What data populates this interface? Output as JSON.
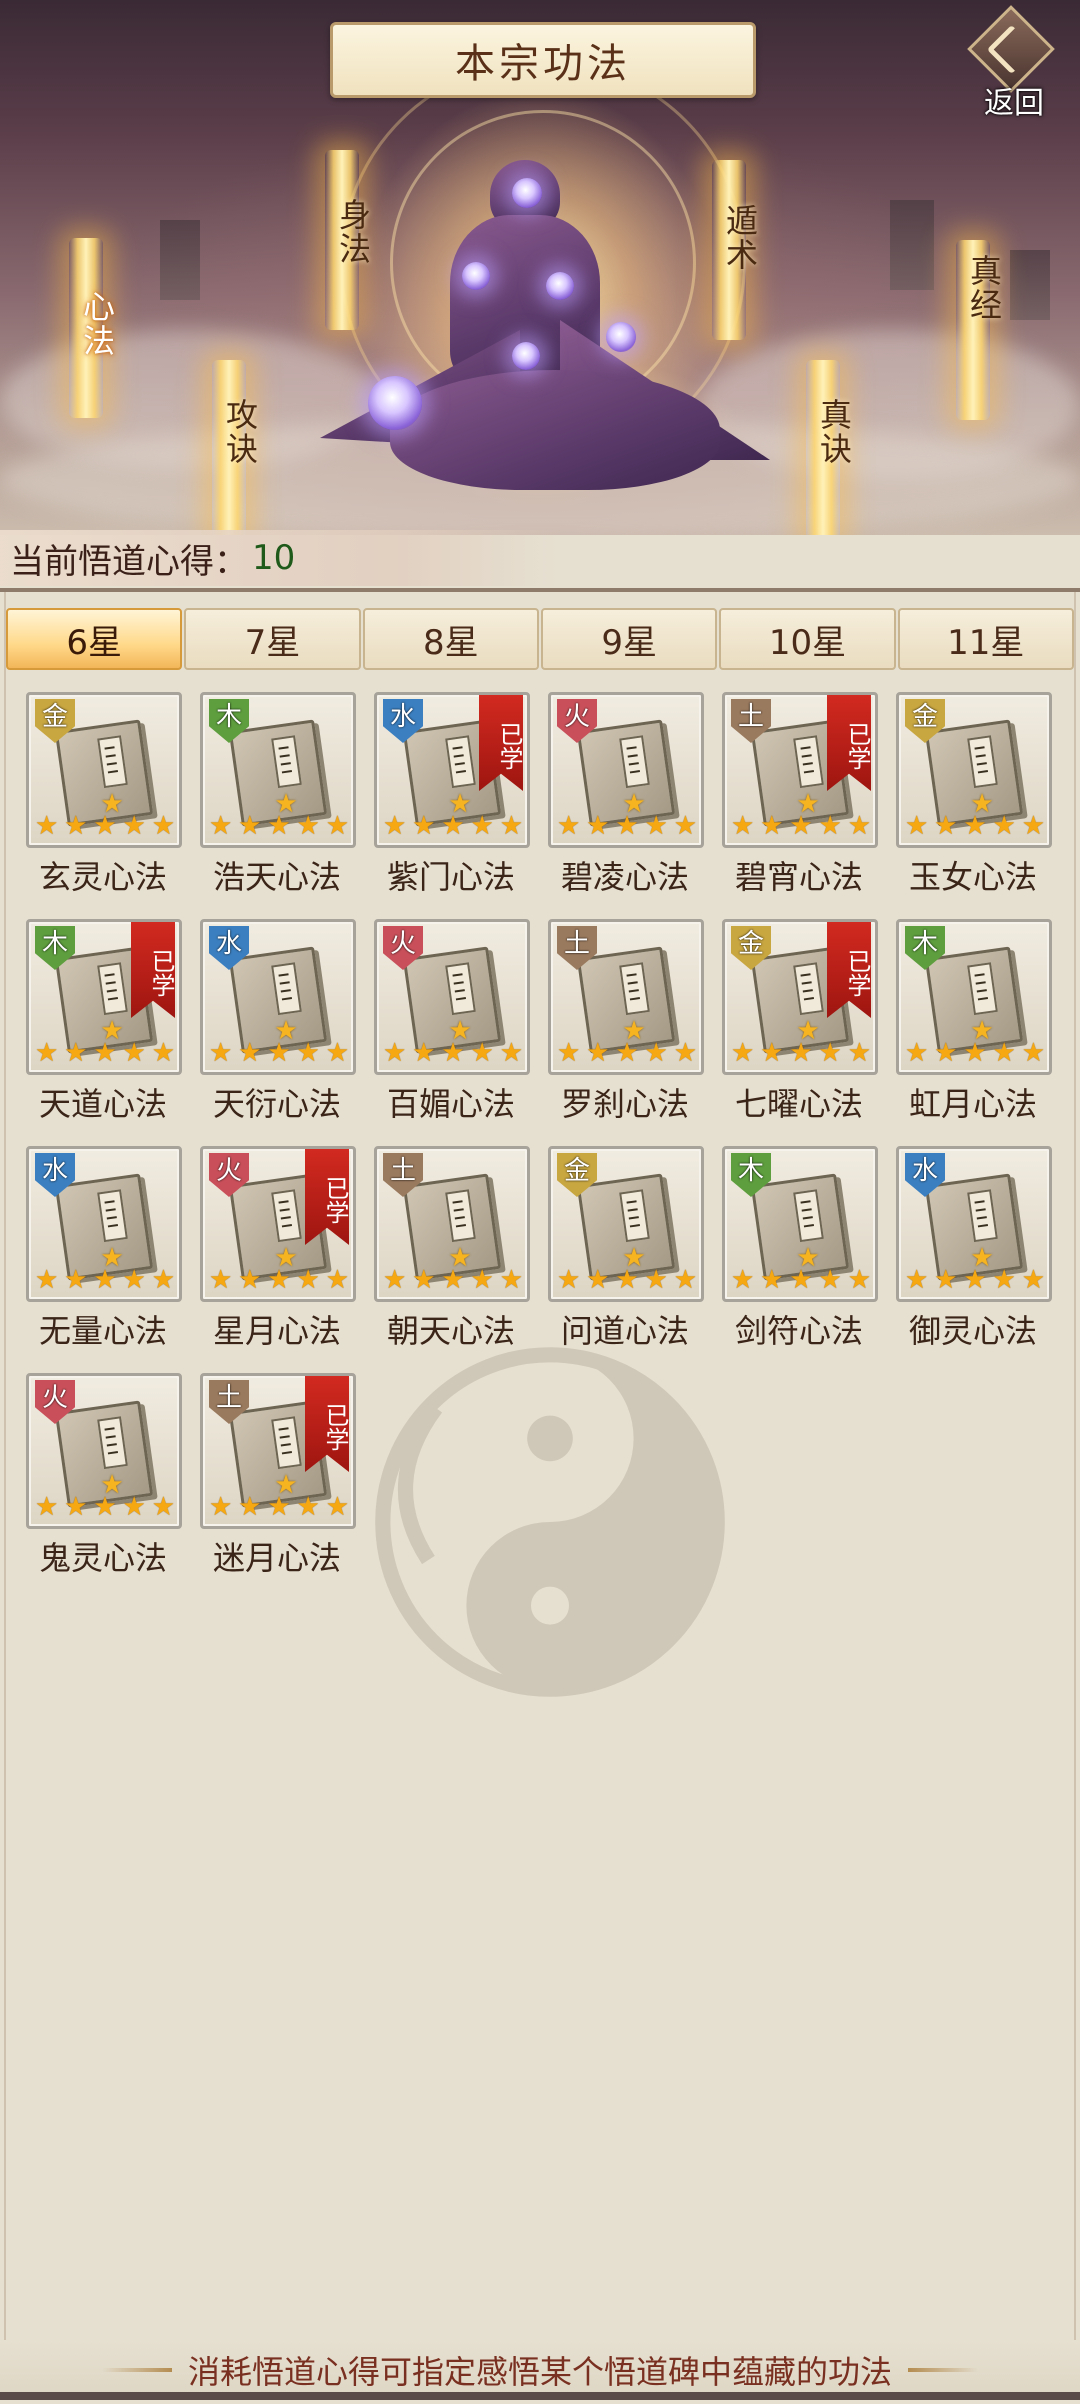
{
  "header": {
    "title": "本宗功法",
    "back_label": "返回",
    "pillars": [
      {
        "id": "xinfa",
        "label": "心法",
        "selected": true
      },
      {
        "id": "shenfa",
        "label": "身法",
        "selected": false
      },
      {
        "id": "gongjue",
        "label": "攻诀",
        "selected": false
      },
      {
        "id": "dunshu",
        "label": "遁术",
        "selected": false
      },
      {
        "id": "zhenjue",
        "label": "真诀",
        "selected": false
      },
      {
        "id": "zhenjing",
        "label": "真经",
        "selected": false
      }
    ]
  },
  "insight": {
    "label": "当前悟道心得：",
    "value": "10"
  },
  "tabs": [
    {
      "label": "6星",
      "active": true
    },
    {
      "label": "7星",
      "active": false
    },
    {
      "label": "8星",
      "active": false
    },
    {
      "label": "9星",
      "active": false
    },
    {
      "label": "10星",
      "active": false
    },
    {
      "label": "11星",
      "active": false
    }
  ],
  "learned_label": "已学",
  "star_glyph": "★",
  "element_colors": {
    "金": "#c8a640",
    "木": "#5e9e3e",
    "水": "#3b7fc0",
    "火": "#c9505a",
    "土": "#9a7a5e"
  },
  "techniques": [
    {
      "name": "玄灵心法",
      "element": "金",
      "learned": false,
      "stars": 5
    },
    {
      "name": "浩天心法",
      "element": "木",
      "learned": false,
      "stars": 5
    },
    {
      "name": "紫门心法",
      "element": "水",
      "learned": true,
      "stars": 5
    },
    {
      "name": "碧凌心法",
      "element": "火",
      "learned": false,
      "stars": 5
    },
    {
      "name": "碧宵心法",
      "element": "土",
      "learned": true,
      "stars": 5
    },
    {
      "name": "玉女心法",
      "element": "金",
      "learned": false,
      "stars": 5
    },
    {
      "name": "天道心法",
      "element": "木",
      "learned": true,
      "stars": 5
    },
    {
      "name": "天衍心法",
      "element": "水",
      "learned": false,
      "stars": 5
    },
    {
      "name": "百媚心法",
      "element": "火",
      "learned": false,
      "stars": 5
    },
    {
      "name": "罗刹心法",
      "element": "土",
      "learned": false,
      "stars": 5
    },
    {
      "name": "七曜心法",
      "element": "金",
      "learned": true,
      "stars": 5
    },
    {
      "name": "虹月心法",
      "element": "木",
      "learned": false,
      "stars": 5
    },
    {
      "name": "无量心法",
      "element": "水",
      "learned": false,
      "stars": 5
    },
    {
      "name": "星月心法",
      "element": "火",
      "learned": true,
      "stars": 5
    },
    {
      "name": "朝天心法",
      "element": "土",
      "learned": false,
      "stars": 5
    },
    {
      "name": "问道心法",
      "element": "金",
      "learned": false,
      "stars": 5
    },
    {
      "name": "剑符心法",
      "element": "木",
      "learned": false,
      "stars": 5
    },
    {
      "name": "御灵心法",
      "element": "水",
      "learned": false,
      "stars": 5
    },
    {
      "name": "鬼灵心法",
      "element": "火",
      "learned": false,
      "stars": 5
    },
    {
      "name": "迷月心法",
      "element": "土",
      "learned": true,
      "stars": 5
    }
  ],
  "footer": {
    "text": "消耗悟道心得可指定感悟某个悟道碑中蕴藏的功法"
  }
}
